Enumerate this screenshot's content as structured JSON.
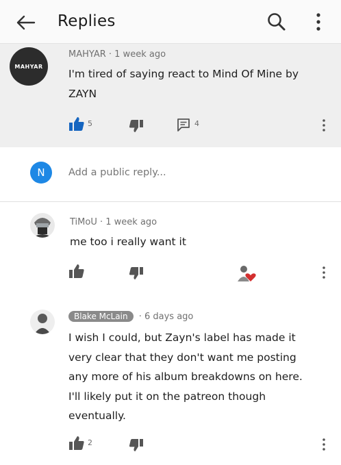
{
  "header": {
    "title": "Replies"
  },
  "parent": {
    "author": "MAHYAR",
    "time": "1 week ago",
    "avatar_text": "MAHYAR",
    "text_lines": [
      "I'm tired of saying react to Mind Of Mine by",
      "ZAYN"
    ],
    "likes": "5",
    "replies": "4",
    "like_color": "#1565c0"
  },
  "reply_input": {
    "avatar_letter": "N",
    "placeholder": "Add a public reply..."
  },
  "replies": [
    {
      "author": "TiMoU",
      "time": "1 week ago",
      "text_lines": [
        "me too i really want it"
      ],
      "likes": ""
    },
    {
      "author": "Blake McLain",
      "time": "6 days ago",
      "text_lines": [
        "I wish I could, but Zayn's label has made it",
        "very clear that they don't want me posting",
        "any more of his album breakdowns on here.",
        "I'll likely put it on the patreon though",
        "eventually."
      ],
      "likes": "2"
    }
  ]
}
